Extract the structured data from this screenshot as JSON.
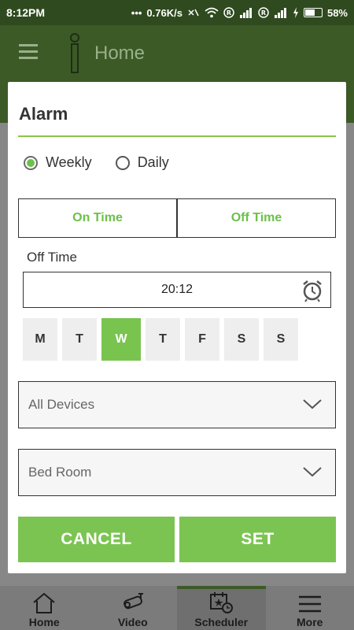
{
  "status": {
    "time": "8:12PM",
    "network_speed": "0.76K/s",
    "battery": "58%",
    "battery_level": 0.58
  },
  "appbar": {
    "title": "Home"
  },
  "dialog": {
    "title": "Alarm",
    "radios": [
      {
        "label": "Weekly",
        "checked": true
      },
      {
        "label": "Daily",
        "checked": false
      }
    ],
    "tabs": [
      {
        "label": "On Time"
      },
      {
        "label": "Off Time"
      }
    ],
    "section_label": "Off Time",
    "time_value": "20:12",
    "days": [
      {
        "label": "M",
        "selected": false
      },
      {
        "label": "T",
        "selected": false
      },
      {
        "label": "W",
        "selected": true
      },
      {
        "label": "T",
        "selected": false
      },
      {
        "label": "F",
        "selected": false
      },
      {
        "label": "S",
        "selected": false
      },
      {
        "label": "S",
        "selected": false
      }
    ],
    "device_select": "All Devices",
    "room_select": "Bed Room",
    "cancel_label": "CANCEL",
    "set_label": "SET"
  },
  "nav": [
    {
      "label": "Home",
      "icon": "home-icon"
    },
    {
      "label": "Video",
      "icon": "camera-icon"
    },
    {
      "label": "Scheduler",
      "icon": "calendar-clock-icon",
      "active": true
    },
    {
      "label": "More",
      "icon": "menu-icon"
    }
  ],
  "colors": {
    "accent": "#7cc452",
    "dark_green": "#3b5a26"
  }
}
